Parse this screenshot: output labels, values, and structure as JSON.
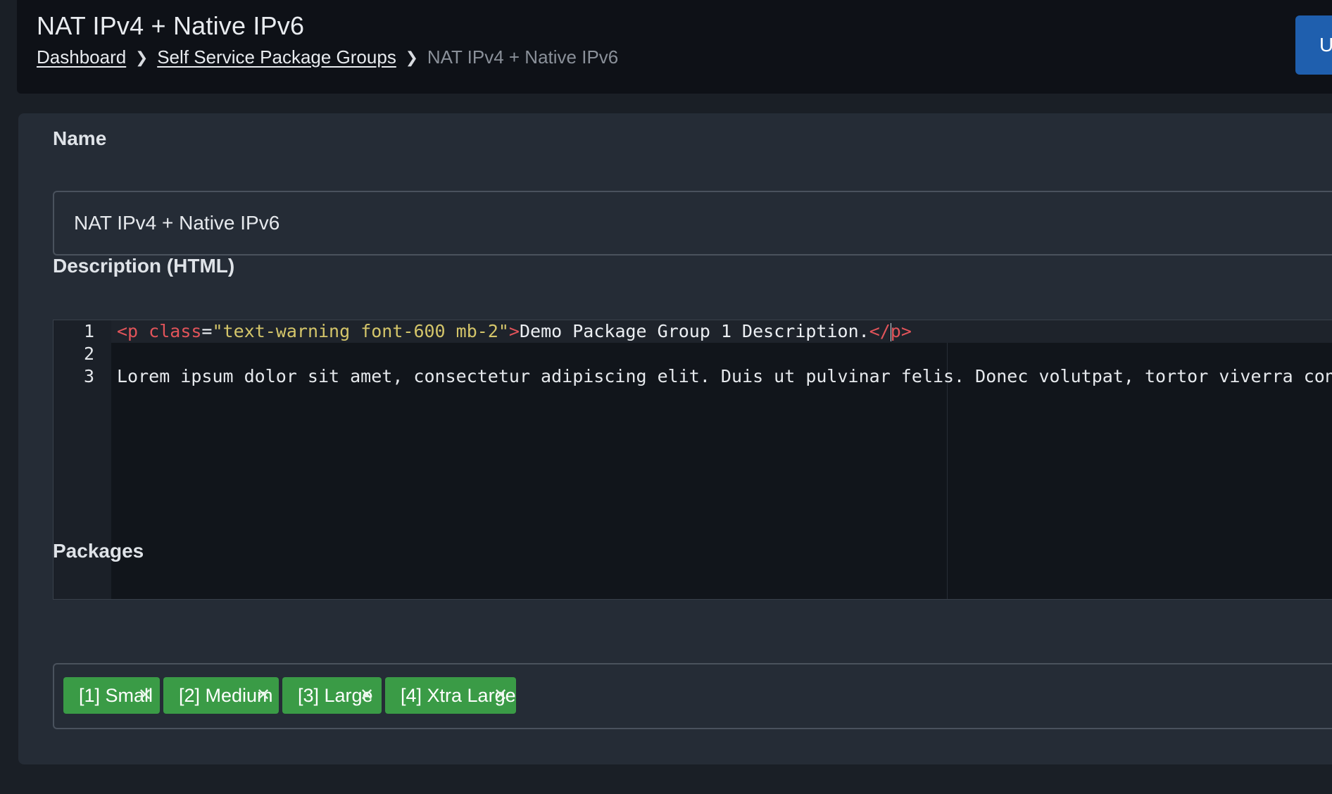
{
  "header": {
    "title": "NAT IPv4 + Native IPv6",
    "breadcrumb": [
      {
        "label": "Dashboard"
      },
      {
        "label": "Self Service Package Groups"
      },
      {
        "label": "NAT IPv4 + Native IPv6"
      }
    ],
    "separator_icon": "chevron-right-icon",
    "action_button_label": "U"
  },
  "form": {
    "name_label": "Name",
    "name_value": "NAT IPv4 + Native IPv6",
    "description_label": "Description (HTML)",
    "editor": {
      "line_numbers": [
        "1",
        "2",
        "3"
      ],
      "line1": {
        "open_tag_start": "<p",
        "attr_name": " class",
        "equals": "=",
        "attr_value": "\"text-warning font-600 mb-2\"",
        "open_tag_end": ">",
        "text": "Demo Package Group 1 Description.",
        "close_tag_start": "</",
        "close_tag_name": "p",
        "close_tag_end": ">"
      },
      "line2": "",
      "line3": "Lorem ipsum dolor sit amet, consectetur adipiscing elit. Duis ut pulvinar felis. Donec volutpat, tortor viverra consecte"
    },
    "packages_label": "Packages",
    "packages": [
      {
        "label": "[1] Small"
      },
      {
        "label": "[2] Medium"
      },
      {
        "label": "[3] Large"
      },
      {
        "label": "[4] Xtra Large"
      }
    ],
    "remove_icon": "close-icon",
    "tag_color": "#3a9b46"
  },
  "colors": {
    "background": "#1a1f26",
    "header_bg": "#0e1117",
    "card_bg": "#252c36",
    "editor_bg": "#11151b",
    "primary_button": "#1f5fae",
    "syntax_tag": "#e2545a",
    "syntax_string": "#d4c56a"
  }
}
